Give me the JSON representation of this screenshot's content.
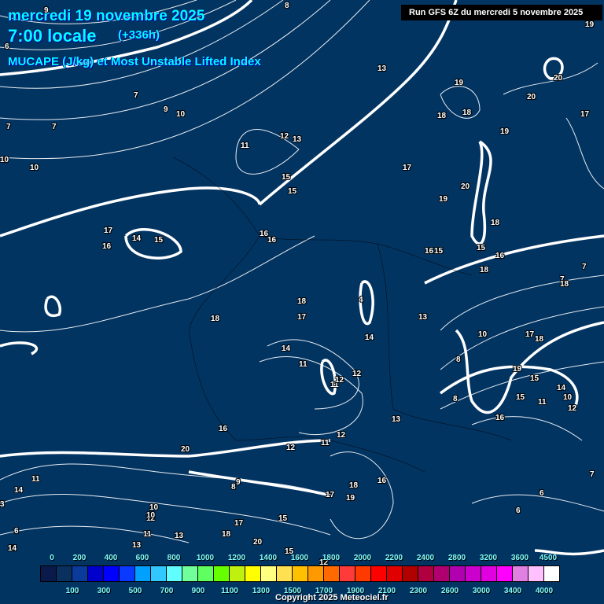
{
  "header": {
    "date": "mercredi 19 novembre 2025",
    "time": "7:00 locale",
    "lead": "(+336h)",
    "parameter": "MUCAPE (J/kg) et Most Unstable Lifted Index",
    "run": "Run GFS 6Z du mercredi 5 novembre 2025"
  },
  "colorbar": {
    "top_labels": [
      "0",
      "200",
      "400",
      "600",
      "800",
      "1000",
      "1200",
      "1400",
      "1600",
      "1800",
      "2000",
      "2200",
      "2400",
      "2800",
      "3200",
      "3600",
      "4500"
    ],
    "bottom_labels": [
      "100",
      "300",
      "500",
      "700",
      "900",
      "1100",
      "1300",
      "1500",
      "1700",
      "1900",
      "2100",
      "2300",
      "2600",
      "3000",
      "3400",
      "4000"
    ],
    "colors": [
      "#0a1a4a",
      "#0a3060",
      "#0a3a9a",
      "#0000cc",
      "#0000ff",
      "#0a3aff",
      "#00a0ff",
      "#30c8ff",
      "#60ffff",
      "#70ff9a",
      "#60ff60",
      "#66ff00",
      "#c0f010",
      "#ffff00",
      "#ffff80",
      "#ffe050",
      "#ffc000",
      "#ff9900",
      "#ff6a00",
      "#ff3a3a",
      "#ff3a00",
      "#ff0000",
      "#e00000",
      "#b00000",
      "#b00040",
      "#b00070",
      "#b000b0",
      "#cc00cc",
      "#e000e0",
      "#ff00ff",
      "#e080e0",
      "#ffc0ff",
      "#ffffff"
    ]
  },
  "copyright": "Copyright 2025 Meteociel.fr",
  "map": {
    "labels": [
      "8",
      "9",
      "6",
      "7",
      "7",
      "7",
      "9",
      "10",
      "10",
      "10",
      "13",
      "19",
      "20",
      "20",
      "17",
      "18",
      "18",
      "19",
      "19",
      "11",
      "12",
      "13",
      "15",
      "15",
      "17",
      "20",
      "19",
      "18",
      "17",
      "14",
      "15",
      "16",
      "16",
      "16",
      "16",
      "15",
      "15",
      "16",
      "18",
      "18",
      "18",
      "17",
      "4",
      "13",
      "14",
      "14",
      "11",
      "11",
      "12",
      "12",
      "13",
      "19",
      "15",
      "16",
      "15",
      "11",
      "14",
      "10",
      "12",
      "20",
      "16",
      "12",
      "12",
      "11",
      "14",
      "11",
      "9",
      "8",
      "18",
      "19",
      "16",
      "17",
      "10",
      "12",
      "10",
      "11",
      "13",
      "17",
      "15",
      "18",
      "20",
      "15",
      "12",
      "6",
      "6",
      "13",
      "7",
      "3",
      "16",
      "14",
      "6",
      "7",
      "18",
      "8",
      "7",
      "17",
      "18",
      "16",
      "10",
      "8"
    ]
  }
}
